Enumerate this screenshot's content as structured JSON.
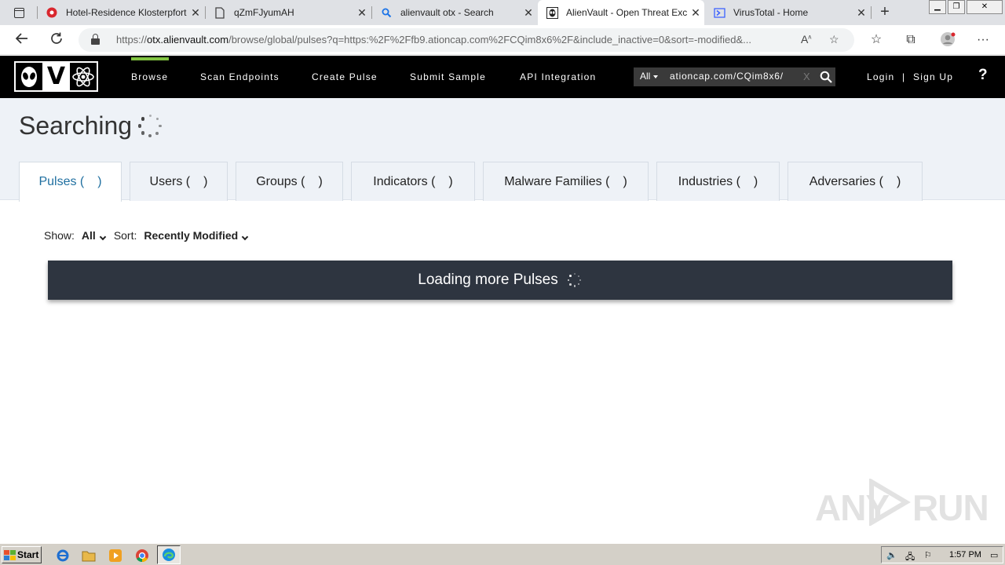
{
  "browser": {
    "tabs": [
      {
        "title": "Hotel-Residence Klosterpforte",
        "icon": "red-shield-icon"
      },
      {
        "title": "qZmFJyumAH",
        "icon": "page-icon"
      },
      {
        "title": "alienvault otx - Search",
        "icon": "search-icon"
      },
      {
        "title": "AlienVault - Open Threat Exchange",
        "icon": "alienvault-icon"
      },
      {
        "title": "VirusTotal - Home",
        "icon": "virustotal-icon"
      }
    ],
    "active_tab": 3,
    "url_scheme": "https://",
    "url_host": "otx.alienvault.com",
    "url_rest": "/browse/global/pulses?q=https:%2F%2Ffb9.ationcap.com%2FCQim8x6%2F&include_inactive=0&sort=-modified&..."
  },
  "otx": {
    "nav": [
      {
        "label": "Browse"
      },
      {
        "label": "Scan Endpoints"
      },
      {
        "label": "Create Pulse"
      },
      {
        "label": "Submit Sample"
      },
      {
        "label": "API Integration"
      }
    ],
    "search_scope": "All",
    "search_query": "ationcap.com/CQim8x6/",
    "clear_symbol": "X",
    "login": "Login",
    "signup": "Sign Up",
    "auth_separator": "|",
    "help": "?"
  },
  "page": {
    "heading": "Searching",
    "tabs": [
      {
        "label": "Pulses (",
        "suffix": ")"
      },
      {
        "label": "Users (",
        "suffix": ")"
      },
      {
        "label": "Groups (",
        "suffix": ")"
      },
      {
        "label": "Indicators (",
        "suffix": ")"
      },
      {
        "label": "Malware Families (",
        "suffix": ")"
      },
      {
        "label": "Industries (",
        "suffix": ")"
      },
      {
        "label": "Adversaries (",
        "suffix": ")"
      }
    ],
    "show_label": "Show:",
    "show_value": "All",
    "sort_label": "Sort:",
    "sort_value": "Recently Modified",
    "loading_text": "Loading more Pulses"
  },
  "watermark": {
    "text_left": "ANY",
    "text_right": "RUN"
  },
  "taskbar": {
    "start": "Start",
    "clock": "1:57 PM"
  },
  "colors": {
    "accent_green": "#81c341",
    "active_tab_text": "#1f6fa0",
    "loadbar_bg": "#2e3540",
    "nav_bg": "#000000",
    "banner_bg": "#eef2f7"
  }
}
